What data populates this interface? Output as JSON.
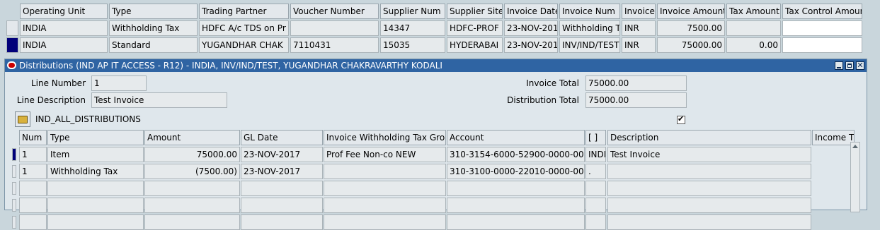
{
  "top_table": {
    "columns": [
      "Operating Unit",
      "Type",
      "Trading Partner",
      "Voucher Number",
      "Supplier Num",
      "Supplier Site",
      "Invoice Date",
      "Invoice Num",
      "Invoice",
      "Invoice Amount",
      "Tax Amount",
      "Tax Control Amour"
    ],
    "rows": [
      [
        "INDIA",
        "Withholding Tax",
        "HDFC A/c TDS on Pr",
        "",
        "14347",
        "HDFC-PROF",
        "23-NOV-201",
        "Withholding Ta",
        "INR",
        "7500.00",
        "",
        ""
      ],
      [
        "INDIA",
        "Standard",
        "YUGANDHAR CHAK",
        "7110431",
        "15035",
        "HYDERABAI",
        "23-NOV-201",
        "INV/IND/TEST",
        "INR",
        "75000.00",
        "0.00",
        ""
      ]
    ]
  },
  "window": {
    "title": "Distributions (IND AP IT ACCESS - R12) - INDIA, INV/IND/TEST, YUGANDHAR CHAKRAVARTHY KODALI",
    "line_number_label": "Line Number",
    "line_number": "1",
    "line_description_label": "Line Description",
    "line_description": "Test Invoice",
    "invoice_total_label": "Invoice Total",
    "invoice_total": "75000.00",
    "distribution_total_label": "Distribution Total",
    "distribution_total": "75000.00",
    "folder_name": "IND_ALL_DISTRIBUTIONS",
    "checkbox_mark": "✔",
    "columns": [
      "Num",
      "Type",
      "Amount",
      "GL Date",
      "Invoice Withholding Tax Grou",
      "Account",
      "[ ]",
      "Description",
      "Income T"
    ],
    "rows": [
      [
        "1",
        "Item",
        "75000.00",
        "23-NOV-2017",
        "Prof Fee Non-co NEW",
        "310-3154-6000-52900-0000-000-I",
        "INDI",
        "Test Invoice",
        ""
      ],
      [
        "1",
        "Withholding Tax",
        "(7500.00)",
        "23-NOV-2017",
        "",
        "310-3100-0000-22010-0000-000-I",
        ".",
        "",
        ""
      ]
    ],
    "empty_rows": 3
  }
}
